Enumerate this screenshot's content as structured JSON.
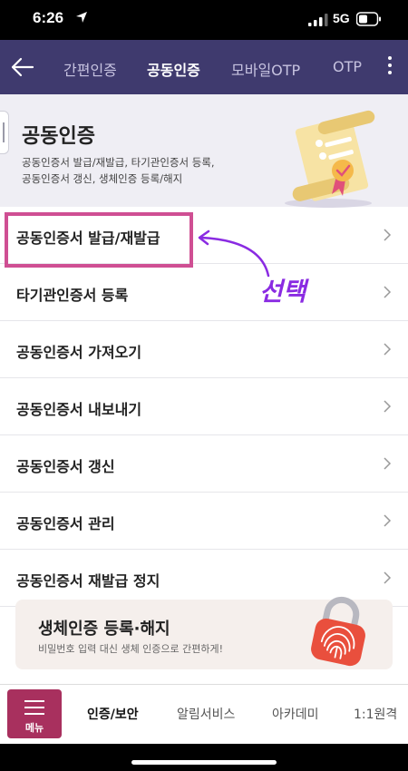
{
  "status_bar": {
    "time": "6:26",
    "network": "5G"
  },
  "navbar": {
    "tabs": [
      {
        "label": "간편인증"
      },
      {
        "label": "공동인증"
      },
      {
        "label": "모바일OTP"
      },
      {
        "label": "OTP"
      }
    ],
    "active_tab": "공동인증"
  },
  "hero": {
    "title": "공동인증",
    "desc_line1": "공동인증서 발급/재발급, 타기관인증서 등록,",
    "desc_line2": "공동인증서 갱신, 생체인증 등록/해지"
  },
  "menu": {
    "items": [
      {
        "label": "공동인증서 발급/재발급"
      },
      {
        "label": "타기관인증서 등록"
      },
      {
        "label": "공동인증서 가져오기"
      },
      {
        "label": "공동인증서 내보내기"
      },
      {
        "label": "공동인증서 갱신"
      },
      {
        "label": "공동인증서 관리"
      },
      {
        "label": "공동인증서 재발급 정지"
      }
    ]
  },
  "annotation": {
    "text": "선택",
    "color": "#8a2be2",
    "box_color": "#cf4f93"
  },
  "bio_card": {
    "title": "생체인증 등록·해지",
    "desc": "비밀번호 입력 대신 생체 인증으로 간편하게!"
  },
  "bottom_nav": {
    "menu_label": "메뉴",
    "tabs": [
      {
        "label": "인증/보안"
      },
      {
        "label": "알림서비스"
      },
      {
        "label": "아카데미"
      },
      {
        "label": "1:1원격"
      }
    ],
    "active_tab": "인증/보안"
  },
  "colors": {
    "navbar_bg": "#3f3a6e",
    "menu_button_bg": "#a8305e",
    "hero_bg": "#efeef4"
  }
}
